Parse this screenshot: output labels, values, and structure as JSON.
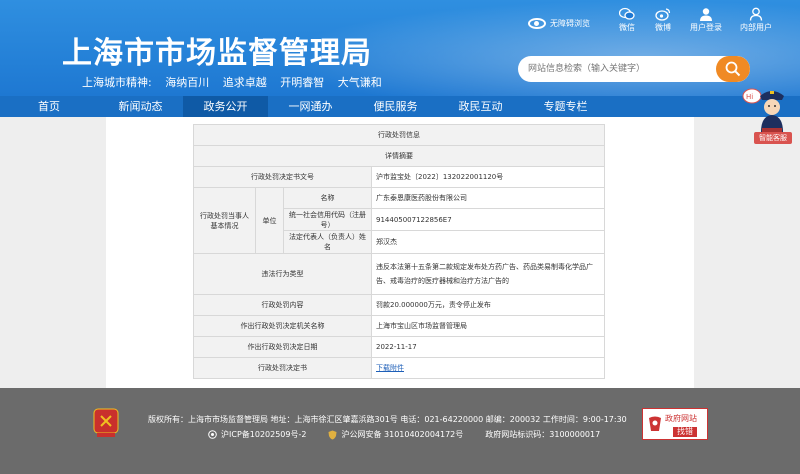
{
  "header": {
    "site_title": "上海市市场监督管理局",
    "spirit_label": "上海城市精神:",
    "spirit": [
      "海纳百川",
      "追求卓越",
      "开明睿智",
      "大气谦和"
    ],
    "accessibility": "无障碍浏览",
    "tools": [
      {
        "icon": "wechat-icon",
        "label": "微信"
      },
      {
        "icon": "weibo-icon",
        "label": "微博"
      },
      {
        "icon": "user-login-icon",
        "label": "用户登录"
      },
      {
        "icon": "intranet-user-icon",
        "label": "内部用户"
      }
    ],
    "search_placeholder": "网站信息检索（输入关键字）"
  },
  "nav": {
    "items": [
      "首页",
      "新闻动态",
      "政务公开",
      "一网通办",
      "便民服务",
      "政民互动",
      "专题专栏"
    ],
    "active": "政务公开"
  },
  "robot": {
    "label": "智能客服"
  },
  "table": {
    "title": "行政处罚信息",
    "subtitle": "详情摘要",
    "decision_no_label": "行政处罚决定书文号",
    "decision_no": "沪市监宝处〔2022〕132022001120号",
    "party_label": "行政处罚当事人基本情况",
    "unit_label": "单位",
    "name_label": "名称",
    "name": "广东泰恩康医药股份有限公司",
    "credit_label": "统一社会信用代码（注册号）",
    "credit": "914405007122856E7",
    "rep_label": "法定代表人（负责人）姓名",
    "rep": "郑汉杰",
    "violation_label": "违法行为类型",
    "violation": "违反本法第十五条第二款规定发布处方药广告、药品类易制毒化学品广告、戒毒治疗的医疗器械和治疗方法广告的",
    "content_label": "行政处罚内容",
    "content": "罚款20.000000万元，责令停止发布",
    "org_label": "作出行政处罚决定机关名称",
    "org": "上海市宝山区市场监督管理局",
    "date_label": "作出行政处罚决定日期",
    "date": "2022-11-17",
    "doc_label": "行政处罚决定书",
    "doc_link": "下载附件"
  },
  "footer": {
    "line1": "版权所有：上海市市场监督管理局  地址：上海市徐汇区肇嘉浜路301号  电话：021-64220000  邮编：200032  工作时间：9:00-17:30",
    "icp": "沪ICP备10202509号-2",
    "police": "沪公网安备 31010402004172号",
    "site_code": "政府网站标识码：3100000017",
    "gov_badge_1": "政府网站",
    "gov_badge_2": "找错"
  },
  "colors": {
    "header_blue": "#1e78d2",
    "nav_blue": "#1a6fc4",
    "nav_active": "#0f5aa6",
    "search_orange": "#f08a24",
    "footer_gray": "#6b6b6b"
  }
}
